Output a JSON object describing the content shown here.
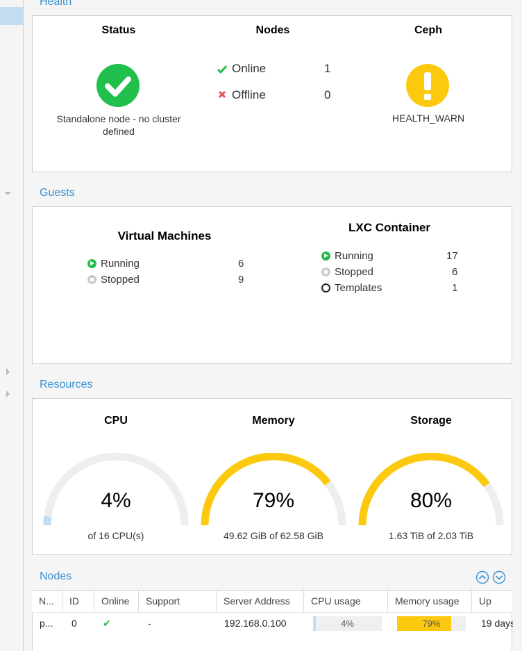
{
  "colors": {
    "accent": "#3892d4",
    "ok": "#21bf4b",
    "warn": "#fcc90f",
    "error": "#e05252",
    "gauge_track": "#eeeeee"
  },
  "health": {
    "title": "Health",
    "status": {
      "label": "Status",
      "icon": "check-circle-icon",
      "text": "Standalone node - no cluster defined"
    },
    "nodes": {
      "label": "Nodes",
      "online_label": "Online",
      "online_count": "1",
      "offline_label": "Offline",
      "offline_count": "0"
    },
    "ceph": {
      "label": "Ceph",
      "icon": "exclamation-circle-icon",
      "text": "HEALTH_WARN"
    }
  },
  "guests": {
    "title": "Guests",
    "vm": {
      "label": "Virtual Machines",
      "running_label": "Running",
      "running": "6",
      "stopped_label": "Stopped",
      "stopped": "9"
    },
    "lxc": {
      "label": "LXC Container",
      "running_label": "Running",
      "running": "17",
      "stopped_label": "Stopped",
      "stopped": "6",
      "templates_label": "Templates",
      "templates": "1"
    }
  },
  "resources": {
    "title": "Resources",
    "cpu": {
      "label": "CPU",
      "percent": 4,
      "value_text": "4%",
      "sub": "of 16 CPU(s)",
      "color": "#c2ddf2"
    },
    "memory": {
      "label": "Memory",
      "percent": 79,
      "value_text": "79%",
      "sub": "49.62 GiB of 62.58 GiB",
      "color": "#fcc90f"
    },
    "storage": {
      "label": "Storage",
      "percent": 80,
      "value_text": "80%",
      "sub": "1.63 TiB of 2.03 TiB",
      "color": "#fcc90f"
    }
  },
  "nodes": {
    "title": "Nodes",
    "columns": [
      "N...",
      "ID",
      "Online",
      "Support",
      "Server Address",
      "CPU usage",
      "Memory usage",
      "Up"
    ],
    "rows": [
      {
        "name": "p...",
        "id": "0",
        "online": "✔",
        "support": "-",
        "address": "192.168.0.100",
        "cpu": 4,
        "cpu_text": "4%",
        "mem": 79,
        "mem_text": "79%",
        "uptime": "19 days"
      }
    ]
  }
}
